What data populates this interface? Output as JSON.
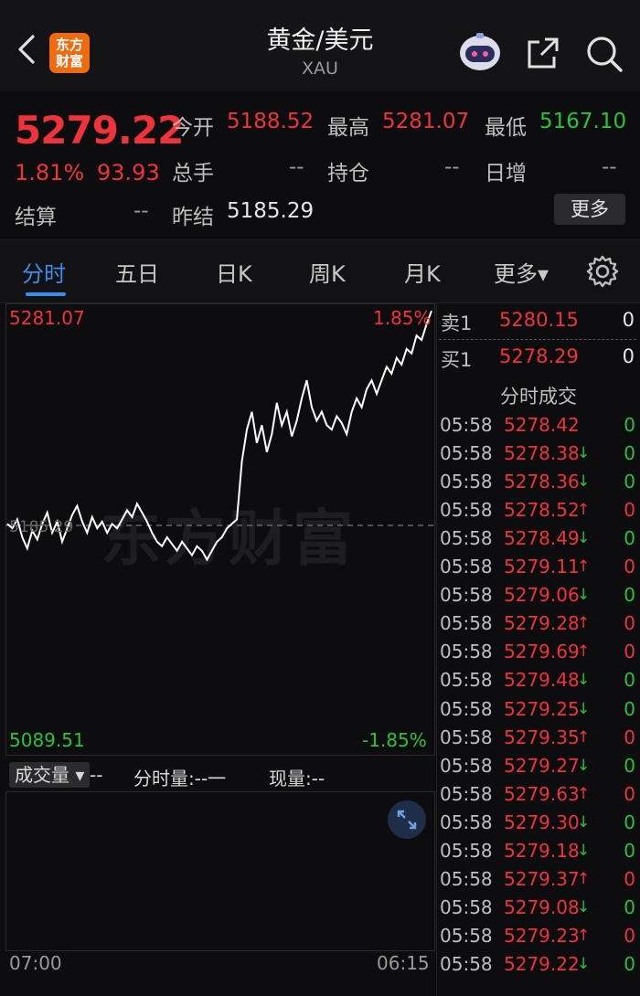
{
  "header": {
    "logo_line1": "东方",
    "logo_line2": "财富",
    "title": "黄金/美元",
    "subtitle": "XAU"
  },
  "quote": {
    "last_price": "5279.22",
    "change_pct": "1.81%",
    "change_val": "93.93",
    "fields": [
      {
        "label": "今开",
        "value": "5188.52",
        "color": "red"
      },
      {
        "label": "最高",
        "value": "5281.07",
        "color": "red"
      },
      {
        "label": "最低",
        "value": "5167.10",
        "color": "green"
      },
      {
        "label": "总手",
        "value": "--",
        "color": "grey"
      },
      {
        "label": "持仓",
        "value": "--",
        "color": "grey"
      },
      {
        "label": "日增",
        "value": "--",
        "color": "grey"
      },
      {
        "label": "结算",
        "value": "--",
        "color": "grey"
      },
      {
        "label": "昨结",
        "value": "5185.29",
        "color": "white"
      }
    ],
    "more_label": "更多"
  },
  "tabs": [
    {
      "label": "分时",
      "active": true
    },
    {
      "label": "五日"
    },
    {
      "label": "日K"
    },
    {
      "label": "周K"
    },
    {
      "label": "月K"
    },
    {
      "label": "更多▾"
    }
  ],
  "chart": {
    "watermark": "东方财富",
    "y_max": "5281.07",
    "y_max_pct": "1.85%",
    "y_min": "5089.51",
    "y_min_pct": "-1.85%",
    "y_mid": "5185.29",
    "x_start": "07:00",
    "x_end": "06:15",
    "colors": {
      "line": "#ffffff",
      "ref": "#7a7a7a",
      "up": "#f0323c",
      "down": "#25c43a"
    }
  },
  "volume": {
    "select_label": "成交量 ▾",
    "select_value": "--",
    "label2": "分时量:--一",
    "label3": "现量:--"
  },
  "order_book": {
    "ask": {
      "label": "卖1",
      "price": "5280.15",
      "vol": "0"
    },
    "bid": {
      "label": "买1",
      "price": "5278.29",
      "vol": "0"
    },
    "ticks_title": "分时成交",
    "ticks": [
      {
        "time": "05:58",
        "price": "5278.42",
        "arrow": "",
        "vol": "0",
        "dir": "green"
      },
      {
        "time": "05:58",
        "price": "5278.38",
        "arrow": "↓",
        "vol": "0",
        "dir": "green"
      },
      {
        "time": "05:58",
        "price": "5278.36",
        "arrow": "↓",
        "vol": "0",
        "dir": "green"
      },
      {
        "time": "05:58",
        "price": "5278.52",
        "arrow": "↑",
        "vol": "0",
        "dir": "red"
      },
      {
        "time": "05:58",
        "price": "5278.49",
        "arrow": "↓",
        "vol": "0",
        "dir": "green"
      },
      {
        "time": "05:58",
        "price": "5279.11",
        "arrow": "↑",
        "vol": "0",
        "dir": "red"
      },
      {
        "time": "05:58",
        "price": "5279.06",
        "arrow": "↓",
        "vol": "0",
        "dir": "green"
      },
      {
        "time": "05:58",
        "price": "5279.28",
        "arrow": "↑",
        "vol": "0",
        "dir": "red"
      },
      {
        "time": "05:58",
        "price": "5279.69",
        "arrow": "↑",
        "vol": "0",
        "dir": "red"
      },
      {
        "time": "05:58",
        "price": "5279.48",
        "arrow": "↓",
        "vol": "0",
        "dir": "green"
      },
      {
        "time": "05:58",
        "price": "5279.25",
        "arrow": "↓",
        "vol": "0",
        "dir": "green"
      },
      {
        "time": "05:58",
        "price": "5279.35",
        "arrow": "↑",
        "vol": "0",
        "dir": "red"
      },
      {
        "time": "05:58",
        "price": "5279.27",
        "arrow": "↓",
        "vol": "0",
        "dir": "green"
      },
      {
        "time": "05:58",
        "price": "5279.63",
        "arrow": "↑",
        "vol": "0",
        "dir": "red"
      },
      {
        "time": "05:58",
        "price": "5279.30",
        "arrow": "↓",
        "vol": "0",
        "dir": "green"
      },
      {
        "time": "05:58",
        "price": "5279.18",
        "arrow": "↓",
        "vol": "0",
        "dir": "green"
      },
      {
        "time": "05:58",
        "price": "5279.37",
        "arrow": "↑",
        "vol": "0",
        "dir": "red"
      },
      {
        "time": "05:58",
        "price": "5279.08",
        "arrow": "↓",
        "vol": "0",
        "dir": "green"
      },
      {
        "time": "05:58",
        "price": "5279.23",
        "arrow": "↑",
        "vol": "0",
        "dir": "red"
      },
      {
        "time": "05:58",
        "price": "5279.22",
        "arrow": "↓",
        "vol": "0",
        "dir": "green"
      }
    ]
  },
  "chart_data": {
    "type": "line",
    "ylim": [
      5089.51,
      5281.07
    ],
    "reference": 5185.29,
    "series": [
      {
        "values": [
          5186,
          5184,
          5188,
          5180,
          5175,
          5183,
          5179,
          5186,
          5191,
          5182,
          5187,
          5178,
          5184,
          5190,
          5194,
          5187,
          5182,
          5189,
          5184,
          5187,
          5182,
          5186,
          5184,
          5188,
          5192,
          5189,
          5195,
          5191,
          5187,
          5182,
          5178,
          5176,
          5180,
          5177,
          5174,
          5178,
          5175,
          5172,
          5176,
          5174,
          5170,
          5174,
          5178,
          5180,
          5184,
          5186,
          5188,
          5214,
          5228,
          5236,
          5222,
          5230,
          5218,
          5226,
          5240,
          5230,
          5236,
          5225,
          5232,
          5242,
          5250,
          5238,
          5232,
          5236,
          5230,
          5228,
          5234,
          5231,
          5226,
          5236,
          5242,
          5238,
          5246,
          5250,
          5244,
          5250,
          5256,
          5253,
          5260,
          5257,
          5264,
          5262,
          5270,
          5268,
          5275,
          5281
        ]
      }
    ]
  }
}
